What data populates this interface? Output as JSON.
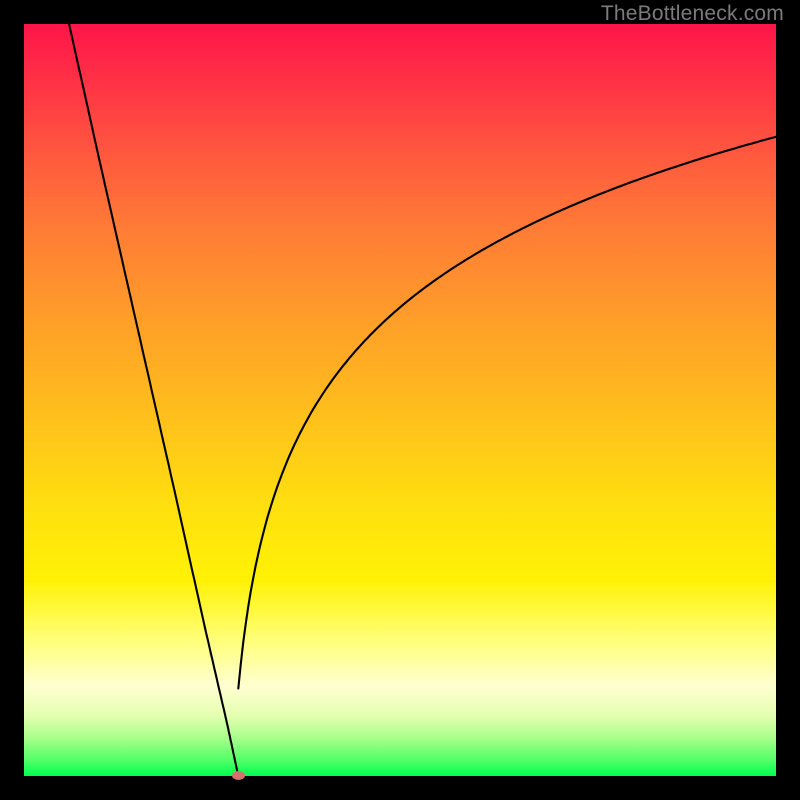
{
  "watermark": "TheBottleneck.com",
  "colors": {
    "frame": "#000000",
    "dot": "#d6726d",
    "gradient_top": "#ff1548",
    "gradient_bottom": "#00ff51"
  },
  "chart_data": {
    "type": "line",
    "title": "",
    "xlabel": "",
    "ylabel": "",
    "xlim": [
      0,
      100
    ],
    "ylim": [
      0,
      100
    ],
    "grid": false,
    "legend": false,
    "series": [
      {
        "name": "left-branch",
        "x": [
          6,
          10,
          15,
          20,
          24,
          27,
          28.5
        ],
        "values": [
          100,
          82,
          60,
          38,
          20,
          7,
          0
        ]
      },
      {
        "name": "right-branch",
        "x": [
          28.5,
          30,
          33,
          37,
          42,
          48,
          55,
          63,
          72,
          82,
          92,
          100
        ],
        "values": [
          0,
          7,
          20,
          35,
          48,
          58,
          66,
          72,
          77,
          80,
          83,
          85
        ]
      }
    ],
    "annotations": [
      {
        "name": "minimum-dot",
        "x": 28.5,
        "y": 0
      }
    ]
  }
}
